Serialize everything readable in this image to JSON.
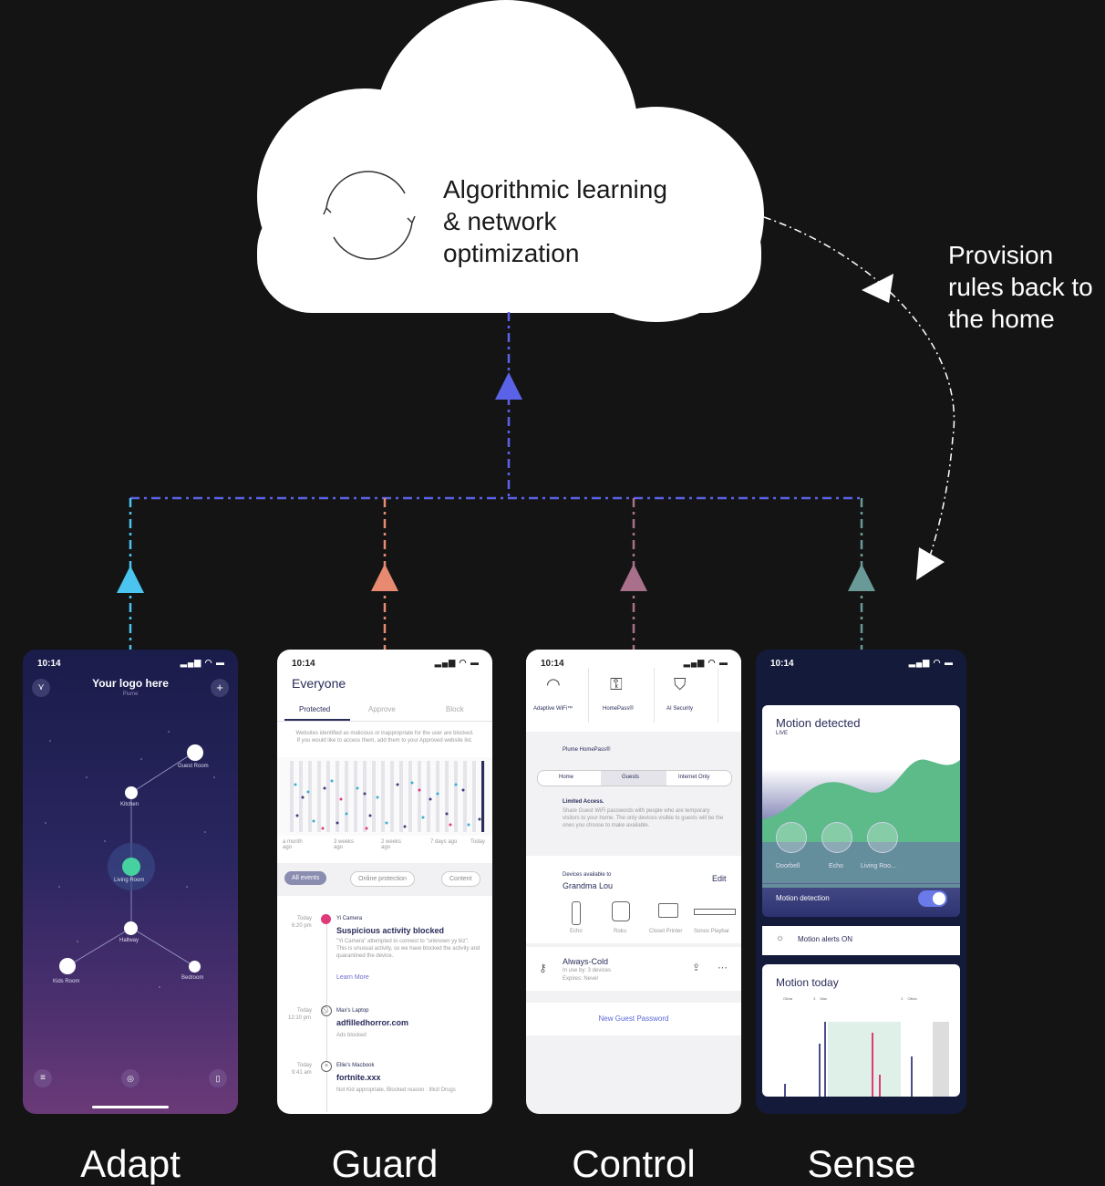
{
  "cloud": {
    "text_lines": [
      "Algorithmic learning",
      "& network",
      "optimization"
    ]
  },
  "side_note": {
    "lines": [
      "Provision",
      "rules back to",
      "the home"
    ]
  },
  "captions": [
    "Adapt",
    "Guard",
    "Control",
    "Sense"
  ],
  "colors": {
    "central_line": "#5a63e8",
    "adapt": "#4cc4f0",
    "guard": "#e88a70",
    "control": "#a8708a",
    "sense": "#6a9a98"
  },
  "adapt_phone": {
    "time": "10:14",
    "signal": "…▎ ◠ ▬",
    "title": "Your logo here",
    "subtitle": "Plume",
    "rooms": [
      "Guest Room",
      "Kitchen",
      "Living Room",
      "Hallway",
      "Kids Room",
      "Bedroom"
    ]
  },
  "guard_phone": {
    "time": "10:14",
    "title": "Everyone",
    "tabs": [
      "Protected",
      "Approve",
      "Block"
    ],
    "info": "Websites identified as malicious or inappropriate for the user are blocked. If you would like to access them, add them to your Approved website list.",
    "timeline_labels": [
      "a month ago",
      "3 weeks ago",
      "2 weeks ago",
      "7 days ago",
      "Today"
    ],
    "filters": [
      "All events",
      "Online protection",
      "Content"
    ],
    "events": [
      {
        "when": "Today",
        "time": "6:20 pm",
        "device": "Yi Camera",
        "title": "Suspicious activity blocked",
        "body": "\"Yi Camera\" attempted to connect to \"unknown yy biz\". This is unusual activity, so we have blocked the activity and quarantined the device.",
        "link": "Learn More"
      },
      {
        "when": "Today",
        "time": "12:10 pm",
        "device": "Max's Laptop",
        "title": "adfilledhorror.com",
        "body": "Ads blocked"
      },
      {
        "when": "Today",
        "time": "9:41 am",
        "device": "Ellie's Macbook",
        "title": "fortnite.xxx",
        "body": "Not Kid appropriate, Blocked reason : Illicit Drugs"
      }
    ]
  },
  "control_phone": {
    "time": "10:14",
    "top_tabs": [
      "Adaptive WiFi™",
      "HomePass®",
      "AI Security"
    ],
    "section": "Plume HomePass®",
    "segments": [
      "Home",
      "Guests",
      "Internet Only"
    ],
    "access_title": "Limited Access.",
    "access_body": "Share Guest WiFi passwords with people who are temporary visitors to your home. The only devices visible to guests will be the ones you choose to make available.",
    "devices_header": "Devices available to",
    "devices_owner": "Grandma Lou",
    "edit": "Edit",
    "devices": [
      "Echo",
      "Roku",
      "Closet Printer",
      "Sonos Playbar"
    ],
    "password_name": "Always-Cold",
    "password_use": "In use by: 3 devices",
    "password_exp": "Expires: Never",
    "new_password": "New Guest Password"
  },
  "sense_phone": {
    "time": "10:14",
    "motion_title": "Motion detected",
    "live": "LIVE",
    "devices": [
      "Doorbell",
      "Echo",
      "Living Roo..."
    ],
    "motion_detection": "Motion detection",
    "alerts": "Motion alerts ON",
    "today_title": "Motion today",
    "today_labels": [
      "Olivia",
      "3",
      "Max",
      "2",
      "Olivia"
    ]
  }
}
